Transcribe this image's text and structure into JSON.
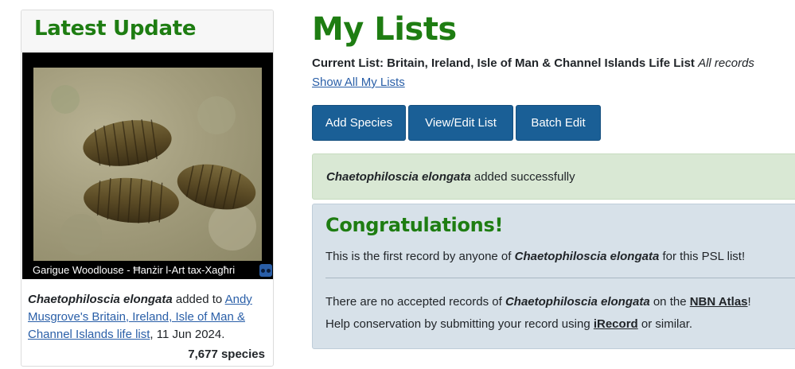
{
  "sidebar": {
    "title": "Latest Update",
    "photo_caption": "Garigue Woodlouse - Ħanżir l-Art tax-Xagħri",
    "species": "Chaetophiloscia elongata",
    "added_to_text": " added to ",
    "list_link": "Andy Musgrove's Britain, Ireland, Isle of Man & Channel Islands life list",
    "date_text": ", 11 Jun 2024.",
    "species_count": "7,677 species"
  },
  "main": {
    "title": "My Lists",
    "current_list_label": "Current List: Britain, Ireland, Isle of Man & Channel Islands Life List",
    "current_list_suffix": "All records",
    "show_all_link": "Show All My Lists",
    "buttons": {
      "add_species": "Add Species",
      "view_edit": "View/Edit List",
      "batch_edit": "Batch Edit"
    },
    "alert": {
      "species": "Chaetophiloscia elongata",
      "text": " added successfully"
    },
    "congrats": {
      "title": "Congratulations!",
      "first_prefix": "This is the first record by anyone of ",
      "first_species": "Chaetophiloscia elongata",
      "first_suffix": " for this PSL list!",
      "nbn_prefix": "There are no accepted records of ",
      "nbn_species": "Chaetophiloscia elongata",
      "nbn_mid": " on the ",
      "nbn_link": "NBN Atlas",
      "nbn_suffix": "!",
      "help_prefix": "Help conservation by submitting your record using ",
      "irecord_link": "iRecord",
      "help_suffix": " or similar."
    }
  },
  "colors": {
    "heading_green": "#1e7d12",
    "button_blue": "#1a5f96",
    "success_bg": "#d9e8d4",
    "info_bg": "#d7e1e9",
    "link_blue": "#2a5fa8"
  },
  "icons": {
    "photo_badge": "flickr-icon"
  }
}
